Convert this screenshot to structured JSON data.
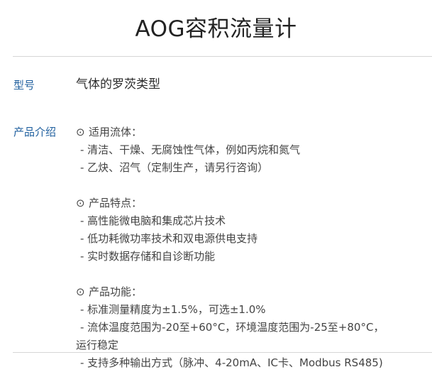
{
  "title": "AOG容积流量计",
  "model": {
    "label": "型号",
    "value": "气体的罗茨类型"
  },
  "intro": {
    "label": "产品介绍",
    "sections": [
      {
        "heading": "适用流体：",
        "items": [
          "- 清洁、干燥、无腐蚀性气体，例如丙烷和氮气",
          "- 乙炔、沼气（定制生产，请另行咨询）"
        ]
      },
      {
        "heading": "产品特点：",
        "items": [
          "- 高性能微电脑和集成芯片技术",
          "- 低功耗微功率技术和双电源供电支持",
          "- 实时数据存储和自诊断功能"
        ]
      },
      {
        "heading": "产品功能：",
        "items": [
          "- 标准测量精度为±1.5%，可选±1.0%",
          "- 流体温度范围为-20至+60°C，环境温度范围为-25至+80°C，",
          "运行稳定",
          "- 支持多种输出方式（脉冲、4-20mA、IC卡、Modbus RS485)"
        ]
      }
    ],
    "heading_icon": "⊙"
  }
}
